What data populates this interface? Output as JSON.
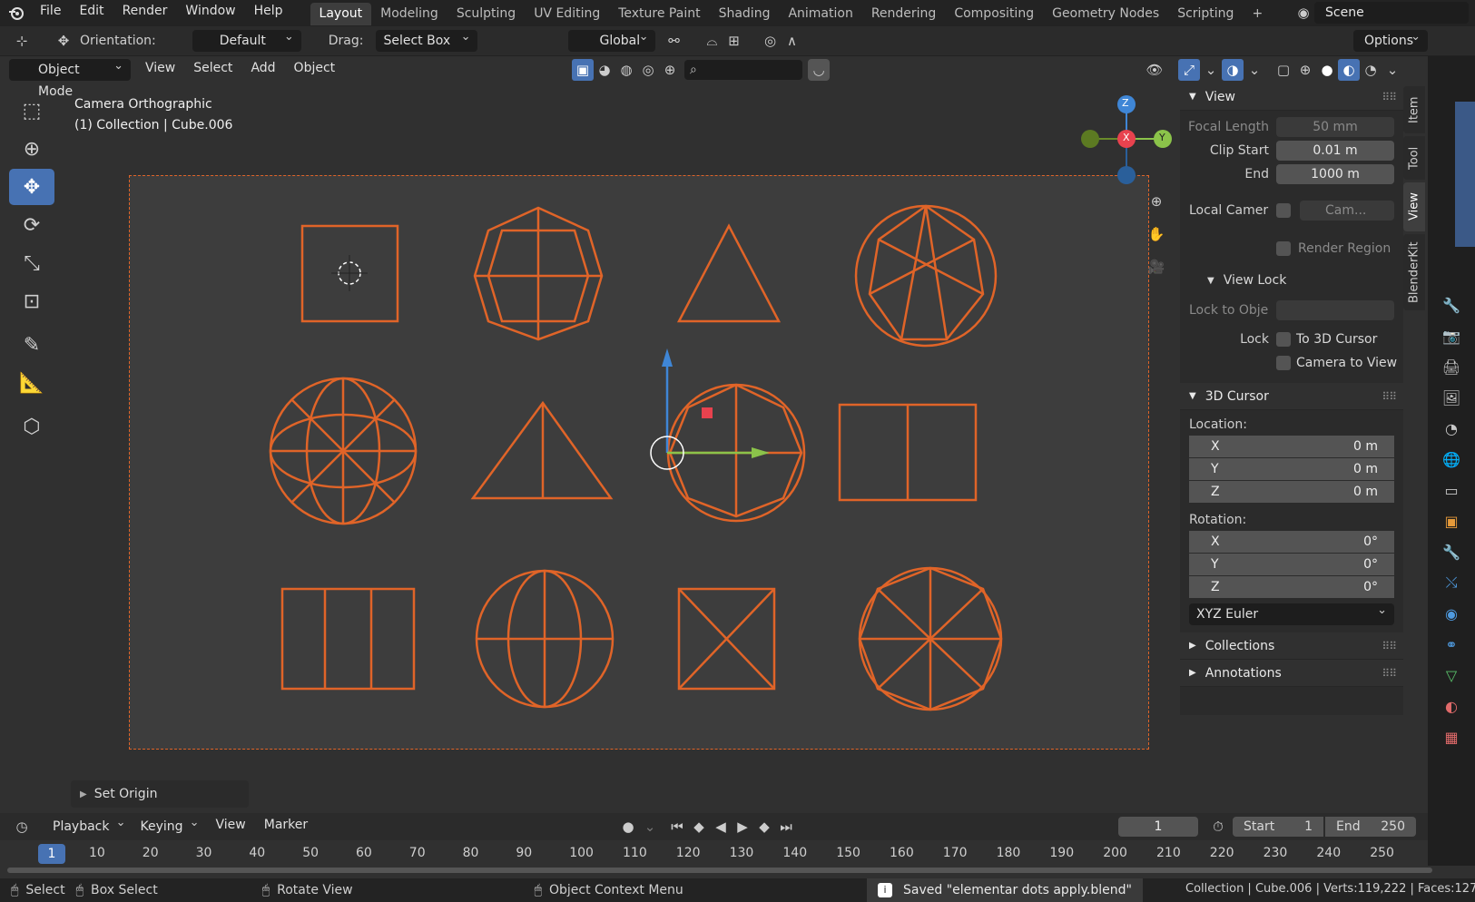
{
  "topbar": {
    "menus": [
      "File",
      "Edit",
      "Render",
      "Window",
      "Help"
    ],
    "workspaces": [
      "Layout",
      "Modeling",
      "Sculpting",
      "UV Editing",
      "Texture Paint",
      "Shading",
      "Animation",
      "Rendering",
      "Compositing",
      "Geometry Nodes",
      "Scripting"
    ],
    "active_workspace": "Layout",
    "scene_label": "Scene"
  },
  "toolheader": {
    "orientation_label": "Orientation:",
    "orientation_value": "Default",
    "drag_label": "Drag:",
    "drag_value": "Select Box",
    "transform_orientation": "Global",
    "options_label": "Options"
  },
  "viewport_header": {
    "mode": "Object Mode",
    "menus": [
      "View",
      "Select",
      "Add",
      "Object"
    ]
  },
  "viewport": {
    "camera_label": "Camera Orthographic",
    "collection_label": "(1) Collection | Cube.006",
    "gizmo_axes": [
      "Z",
      "X",
      "Y"
    ],
    "last_operator": "Set Origin"
  },
  "npanel": {
    "tabs": [
      "Item",
      "Tool",
      "View",
      "BlenderKit"
    ],
    "active_tab": "View",
    "view_section": "View",
    "focal_length_label": "Focal Length",
    "focal_length_value": "50 mm",
    "clip_start_label": "Clip Start",
    "clip_start_value": "0.01 m",
    "end_label": "End",
    "end_value": "1000 m",
    "local_camera_label": "Local Camer",
    "local_camera_value": "Cam...",
    "render_region_label": "Render Region",
    "view_lock_section": "View Lock",
    "lock_to_object_label": "Lock to Obje",
    "lock_label": "Lock",
    "to_3d_cursor_label": "To 3D Cursor",
    "camera_to_view_label": "Camera to View",
    "cursor_section": "3D Cursor",
    "location_label": "Location:",
    "location": [
      {
        "axis": "X",
        "value": "0 m"
      },
      {
        "axis": "Y",
        "value": "0 m"
      },
      {
        "axis": "Z",
        "value": "0 m"
      }
    ],
    "rotation_label": "Rotation:",
    "rotation": [
      {
        "axis": "X",
        "value": "0°"
      },
      {
        "axis": "Y",
        "value": "0°"
      },
      {
        "axis": "Z",
        "value": "0°"
      }
    ],
    "rotation_mode": "XYZ Euler",
    "collections_section": "Collections",
    "annotations_section": "Annotations"
  },
  "timeline": {
    "menus": [
      "Playback",
      "Keying",
      "View",
      "Marker"
    ],
    "current_frame": "1",
    "start_label": "Start",
    "start_value": "1",
    "end_label": "End",
    "end_value": "250",
    "ruler_current": "1",
    "ruler_ticks": [
      "10",
      "20",
      "30",
      "40",
      "50",
      "60",
      "70",
      "80",
      "90",
      "100",
      "110",
      "120",
      "130",
      "140",
      "150",
      "160",
      "170",
      "180",
      "190",
      "200",
      "210",
      "220",
      "230",
      "240",
      "250"
    ]
  },
  "statusbar": {
    "select": "Select",
    "box_select": "Box Select",
    "rotate_view": "Rotate View",
    "context_menu": "Object Context Menu",
    "message": "Saved \"elementar dots apply.blend\"",
    "stats": "Collection | Cube.006 | Verts:119,222 | Faces:127,"
  },
  "colors": {
    "accent": "#4772b3",
    "selection": "#e06428",
    "axis_x": "#e8424e",
    "axis_y": "#8bc34a",
    "axis_z": "#3f86d6"
  }
}
